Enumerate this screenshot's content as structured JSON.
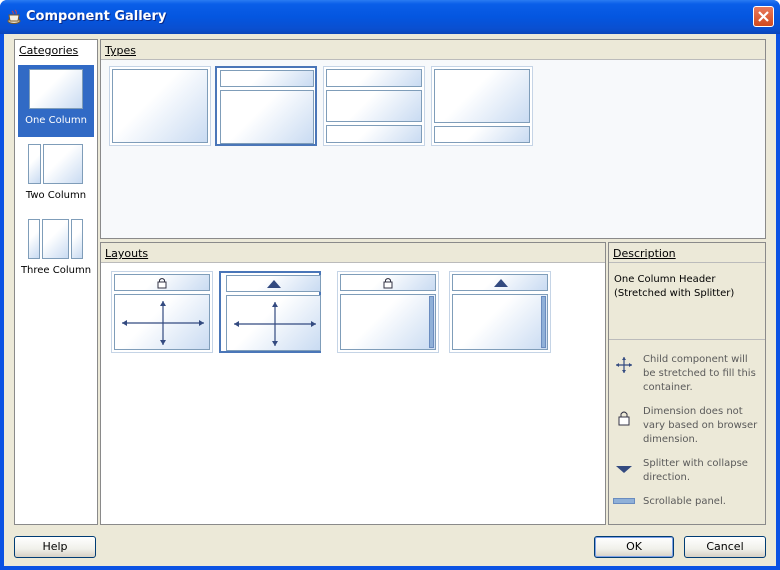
{
  "window": {
    "title": "Component Gallery",
    "close_icon": "close-icon"
  },
  "categories": {
    "header": "Categories",
    "header_mnemonic": "C",
    "items": [
      {
        "label": "One Column",
        "selected": true
      },
      {
        "label": "Two Column",
        "selected": false
      },
      {
        "label": "Three Column",
        "selected": false
      }
    ]
  },
  "types": {
    "header": "Types",
    "header_mnemonic": "T",
    "selected_index": 1
  },
  "layouts": {
    "header": "Layouts",
    "header_mnemonic": "L",
    "selected_index": 1
  },
  "description": {
    "header": "Description",
    "header_mnemonic": "D",
    "text": "One Column Header (Stretched with Splitter)",
    "legend": [
      {
        "icon": "stretch-arrows-icon",
        "text": "Child component will be stretched to fill this container."
      },
      {
        "icon": "lock-icon",
        "text": "Dimension does not vary based on browser dimension."
      },
      {
        "icon": "splitter-triangle-icon",
        "text": "Splitter with collapse direction."
      },
      {
        "icon": "scrollbar-icon",
        "text": "Scrollable panel."
      }
    ]
  },
  "buttons": {
    "help": "Help",
    "ok": "OK",
    "cancel": "Cancel"
  },
  "colors": {
    "title_bar": "#0456e0",
    "selection": "#316ac5",
    "dialog_bg": "#ece9d8",
    "accent_border": "#4a76b8"
  }
}
